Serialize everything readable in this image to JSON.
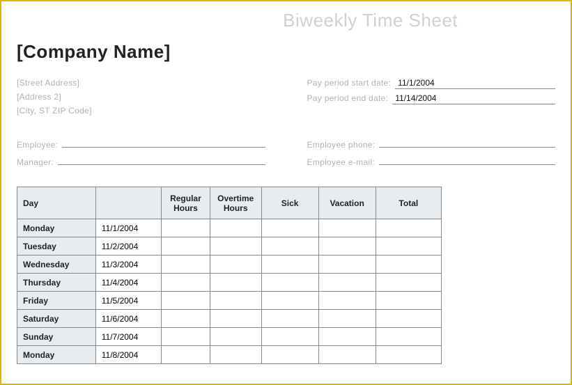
{
  "title": "Biweekly Time Sheet",
  "company": "[Company Name]",
  "address": {
    "street": "[Street Address]",
    "addr2": "[Address 2]",
    "citystatezip": "[City, ST  ZIP Code]"
  },
  "period": {
    "start_label": "Pay period start date:",
    "start_value": "11/1/2004",
    "end_label": "Pay period end date:",
    "end_value": "11/14/2004"
  },
  "labels": {
    "employee": "Employee:",
    "manager": "Manager:",
    "employee_phone": "Employee phone:",
    "employee_email": "Employee e-mail:"
  },
  "columns": {
    "day": "Day",
    "regular": "Regular Hours",
    "overtime": "Overtime Hours",
    "sick": "Sick",
    "vacation": "Vacation",
    "total": "Total"
  },
  "rows": [
    {
      "day": "Monday",
      "date": "11/1/2004"
    },
    {
      "day": "Tuesday",
      "date": "11/2/2004"
    },
    {
      "day": "Wednesday",
      "date": "11/3/2004"
    },
    {
      "day": "Thursday",
      "date": "11/4/2004"
    },
    {
      "day": "Friday",
      "date": "11/5/2004"
    },
    {
      "day": "Saturday",
      "date": "11/6/2004"
    },
    {
      "day": "Sunday",
      "date": "11/7/2004"
    },
    {
      "day": "Monday",
      "date": "11/8/2004"
    }
  ]
}
